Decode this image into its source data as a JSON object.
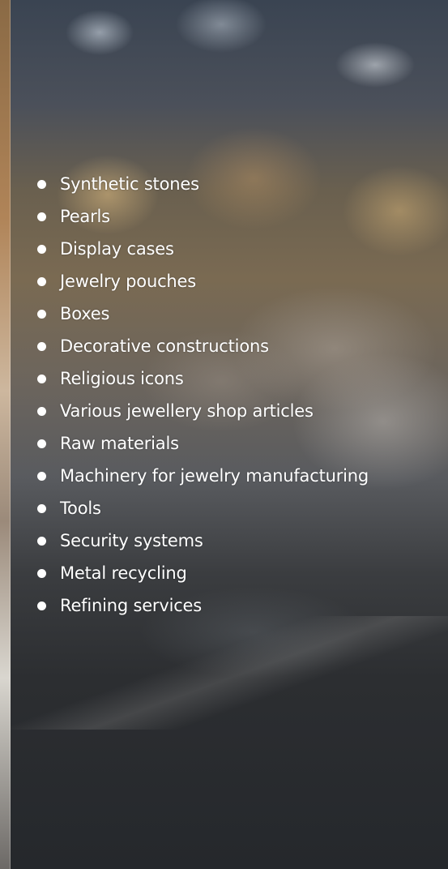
{
  "product_list": {
    "items": [
      "Synthetic stones",
      "Pearls",
      "Display cases",
      "Jewelry pouches",
      "Boxes",
      "Decorative constructions",
      "Religious icons",
      "Various jewellery shop articles",
      "Raw materials",
      "Machinery for jewelry manufacturing",
      "Tools",
      "Security systems",
      "Metal recycling",
      "Refining services"
    ]
  },
  "colors": {
    "text": "#ffffff",
    "bullet": "#ffffff"
  }
}
